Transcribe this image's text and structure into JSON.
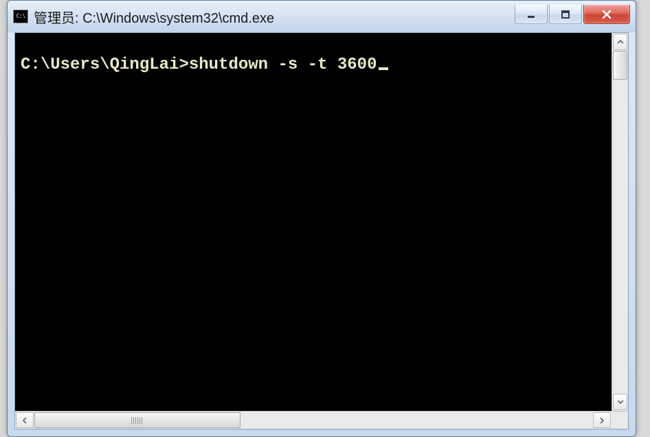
{
  "window": {
    "title": "管理员: C:\\Windows\\system32\\cmd.exe",
    "icon_label": "C:\\"
  },
  "console": {
    "prompt": "C:\\Users\\QingLai>",
    "command": "shutdown -s -t 3600"
  },
  "colors": {
    "console_bg": "#000000",
    "console_fg": "#e8e8c8",
    "aero_light": "#dce8f5",
    "aero_dark": "#c8d9ed",
    "close_red": "#c94434"
  }
}
